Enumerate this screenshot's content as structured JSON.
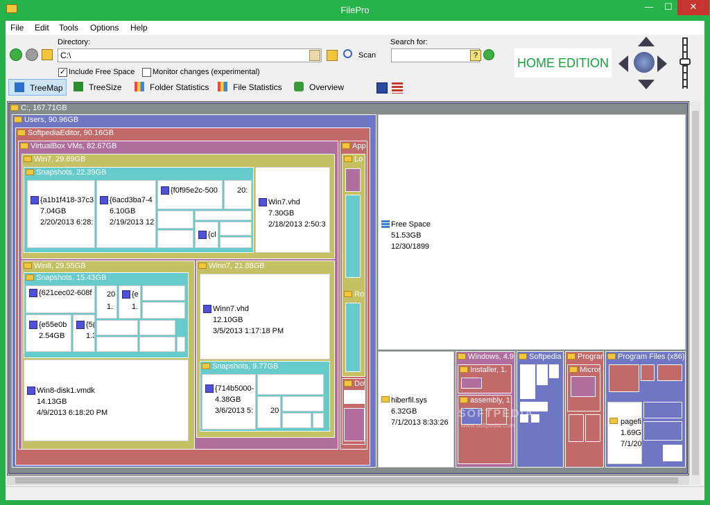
{
  "window": {
    "title": "FilePro",
    "min": "—",
    "max": "☐",
    "close": "✕"
  },
  "menu": [
    "File",
    "Edit",
    "Tools",
    "Options",
    "Help"
  ],
  "directory": {
    "label": "Directory:",
    "value": "C:\\",
    "scan_label": "Scan"
  },
  "search": {
    "label": "Search for:",
    "value": "",
    "help": "?"
  },
  "options": {
    "include_free_space": "Include Free Space",
    "monitor_changes": "Monitor changes (experimental)"
  },
  "tabs": [
    "TreeMap",
    "TreeSize",
    "Folder Statistics",
    "File Statistics",
    "Overview"
  ],
  "edition": "HOME EDITION",
  "treemap": {
    "root": "C:, 167.71GB",
    "users": "Users, 90.96GB",
    "softpedia_editor": "SoftpediaEditor, 90.16GB",
    "virtualbox": "VirtualBox VMs, 82.67GB",
    "app": "App",
    "lo": "Lo",
    "ro": "Ro",
    "dow": "Dow",
    "win7": "Win7, 29.69GB",
    "win7_snapshots": "Snapshots, 22.39GB",
    "win8": "Win8, 29.55GB",
    "win8_snapshots": "Snapshots, 15.43GB",
    "winn7": "Winn7, 21.88GB",
    "winn7_snapshots": "Snapshots, 9.77GB",
    "windows": "Windows, 4.9",
    "softpedia": "Softpedia",
    "program": "Program",
    "program_files_x86": "Program Files (x86)",
    "installer": "Installer, 1.",
    "assembly": "assembly, 1",
    "micros": "Micros",
    "files": {
      "a1b1": {
        "name": "{a1b1f418-37c3",
        "size": "7.04GB",
        "date": "2/20/2013 6:28:"
      },
      "6acd": {
        "name": "{6acd3ba7-4",
        "size": "6.10GB",
        "date": "2/19/2013 12"
      },
      "f0f9": {
        "name": "{f0f95e2c-500"
      },
      "n20a": {
        "name": "20:"
      },
      "cl": {
        "name": "{cl"
      },
      "win7vhd": {
        "name": "Win7.vhd",
        "size": "7.30GB",
        "date": "2/18/2013 2:50:3"
      },
      "621c": {
        "name": "{621cec02-608f"
      },
      "n20b": {
        "name": "20",
        "size": "1."
      },
      "e_small": {
        "name": "{e",
        "size": "1."
      },
      "e55e": {
        "name": "{e55e0b",
        "size": "2.54GB"
      },
      "n5": {
        "name": "{5(",
        "size": "1.3"
      },
      "winn7vhd": {
        "name": "Winn7.vhd",
        "size": "12.10GB",
        "date": "3/5/2013 1:17:18 PM"
      },
      "win8disk": {
        "name": "Win8-disk1.vmdk",
        "size": "14.13GB",
        "date": "4/9/2013 6:18:20 PM"
      },
      "714b": {
        "name": "{714b5000-",
        "size": "4.38GB",
        "date": "3/6/2013 5:"
      },
      "n20c": {
        "name": "20"
      },
      "free": {
        "name": "Free Space",
        "size": "51.53GB",
        "date": "12/30/1899"
      },
      "hiberfil": {
        "name": "hiberfil.sys",
        "size": "6.32GB",
        "date": "7/1/2013 8:33:26"
      },
      "pagefil": {
        "name": "pagefil",
        "size": "1.69GB",
        "date": "7/1/20"
      }
    }
  },
  "colors": {
    "users": "#6f76c4",
    "softpedia": "#c26a6a",
    "virtualbox": "#b06e9e",
    "win": "#c4c063",
    "snap": "#66cbcb"
  },
  "watermark": "SOFTPEDIA",
  "watermark_sub": "www.softpedia.com"
}
